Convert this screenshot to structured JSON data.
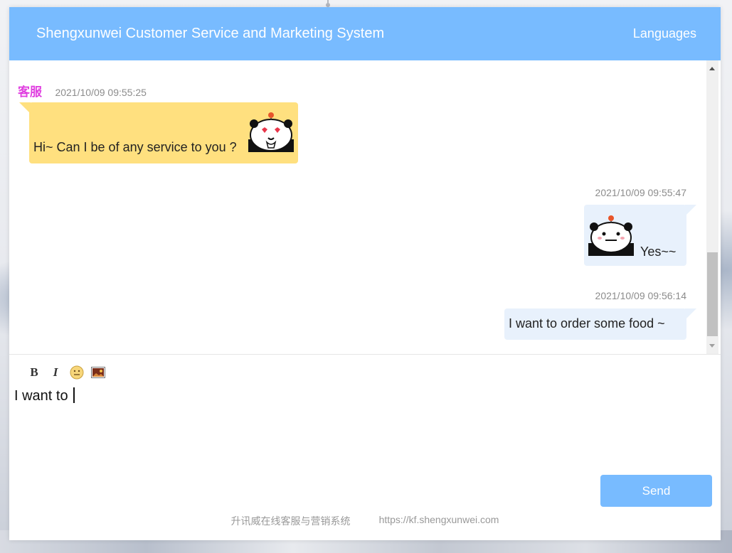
{
  "header": {
    "title": "Shengxunwei Customer Service and Marketing System",
    "languages_label": "Languages"
  },
  "messages": [
    {
      "sender": "客服",
      "time": "2021/10/09 09:55:25",
      "text": "Hi~ Can I be of any service to you ?",
      "sticker": "panda-heart-eyes-sticker"
    },
    {
      "sender": "",
      "time": "2021/10/09 09:55:47",
      "text": "Yes~~",
      "sticker": "panda-smile-sticker"
    },
    {
      "sender": "",
      "time": "2021/10/09 09:56:14",
      "text": "I want to order some food ~"
    }
  ],
  "toolbar": {
    "bold_label": "B",
    "italic_label": "I",
    "emoji_icon": "smiley-face-icon",
    "image_icon": "picture-icon"
  },
  "editor": {
    "value": "I want to "
  },
  "send_label": "Send",
  "footer": {
    "company": "升讯威在线客服与营销系统",
    "url": "https://kf.shengxunwei.com"
  },
  "colors": {
    "header": "#78bbff",
    "agent_bubble": "#ffe07f",
    "user_bubble": "#e8f1fc",
    "agent_name": "#e040e0",
    "send_button": "#78bbff"
  }
}
